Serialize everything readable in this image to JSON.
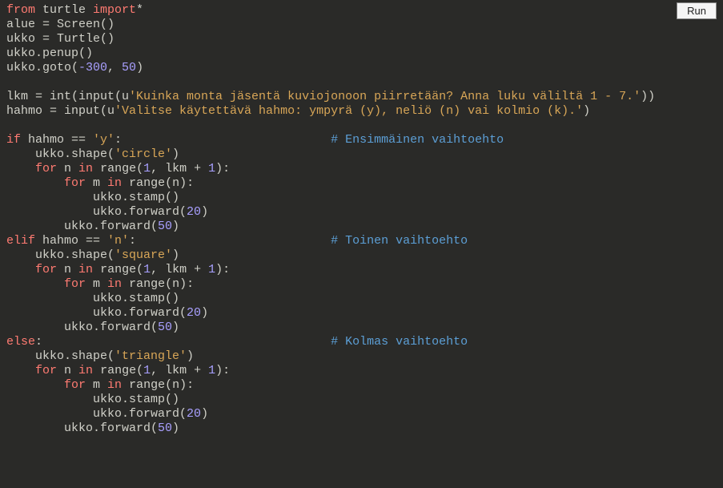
{
  "run_button": "Run",
  "code": {
    "lines": [
      [
        [
          "kw",
          "from"
        ],
        [
          "",
          " turtle "
        ],
        [
          "kw",
          "import"
        ],
        [
          "",
          "*"
        ]
      ],
      [
        [
          "",
          "alue = Screen()"
        ]
      ],
      [
        [
          "",
          "ukko = Turtle()"
        ]
      ],
      [
        [
          "",
          "ukko.penup()"
        ]
      ],
      [
        [
          "",
          "ukko.goto("
        ],
        [
          "num",
          "-300"
        ],
        [
          "",
          ", "
        ],
        [
          "num",
          "50"
        ],
        [
          "",
          ")"
        ]
      ],
      [
        [
          "",
          ""
        ]
      ],
      [
        [
          "",
          "lkm = int(input(u"
        ],
        [
          "str",
          "'Kuinka monta jäsentä kuviojonoon piirretään? Anna luku väliltä 1 - 7.'"
        ],
        [
          "",
          "))"
        ]
      ],
      [
        [
          "",
          "hahmo = input(u"
        ],
        [
          "str",
          "'Valitse käytettävä hahmo: ympyrä (y), neliö (n) vai kolmio (k).'"
        ],
        [
          "",
          ")"
        ]
      ],
      [
        [
          "",
          ""
        ]
      ],
      [
        [
          "kw",
          "if"
        ],
        [
          "",
          " hahmo == "
        ],
        [
          "str",
          "'y'"
        ],
        [
          "",
          ":                             "
        ],
        [
          "cmt",
          "# Ensimmäinen vaihtoehto"
        ]
      ],
      [
        [
          "",
          "    ukko.shape("
        ],
        [
          "str",
          "'circle'"
        ],
        [
          "",
          ")"
        ]
      ],
      [
        [
          "",
          "    "
        ],
        [
          "kw",
          "for"
        ],
        [
          "",
          " n "
        ],
        [
          "kw",
          "in"
        ],
        [
          "",
          " range("
        ],
        [
          "num",
          "1"
        ],
        [
          "",
          ", lkm + "
        ],
        [
          "num",
          "1"
        ],
        [
          "",
          "):"
        ]
      ],
      [
        [
          "",
          "        "
        ],
        [
          "kw",
          "for"
        ],
        [
          "",
          " m "
        ],
        [
          "kw",
          "in"
        ],
        [
          "",
          " range(n):"
        ]
      ],
      [
        [
          "",
          "            ukko.stamp()"
        ]
      ],
      [
        [
          "",
          "            ukko.forward("
        ],
        [
          "num",
          "20"
        ],
        [
          "",
          ")"
        ]
      ],
      [
        [
          "",
          "        ukko.forward("
        ],
        [
          "num",
          "50"
        ],
        [
          "",
          ")"
        ]
      ],
      [
        [
          "kw",
          "elif"
        ],
        [
          "",
          " hahmo == "
        ],
        [
          "str",
          "'n'"
        ],
        [
          "",
          ":                           "
        ],
        [
          "cmt",
          "# Toinen vaihtoehto"
        ]
      ],
      [
        [
          "",
          "    ukko.shape("
        ],
        [
          "str",
          "'square'"
        ],
        [
          "",
          ")"
        ]
      ],
      [
        [
          "",
          "    "
        ],
        [
          "kw",
          "for"
        ],
        [
          "",
          " n "
        ],
        [
          "kw",
          "in"
        ],
        [
          "",
          " range("
        ],
        [
          "num",
          "1"
        ],
        [
          "",
          ", lkm + "
        ],
        [
          "num",
          "1"
        ],
        [
          "",
          "):"
        ]
      ],
      [
        [
          "",
          "        "
        ],
        [
          "kw",
          "for"
        ],
        [
          "",
          " m "
        ],
        [
          "kw",
          "in"
        ],
        [
          "",
          " range(n):"
        ]
      ],
      [
        [
          "",
          "            ukko.stamp()"
        ]
      ],
      [
        [
          "",
          "            ukko.forward("
        ],
        [
          "num",
          "20"
        ],
        [
          "",
          ")"
        ]
      ],
      [
        [
          "",
          "        ukko.forward("
        ],
        [
          "num",
          "50"
        ],
        [
          "",
          ")"
        ]
      ],
      [
        [
          "kw",
          "else"
        ],
        [
          "",
          ":                                        "
        ],
        [
          "cmt",
          "# Kolmas vaihtoehto"
        ]
      ],
      [
        [
          "",
          "    ukko.shape("
        ],
        [
          "str",
          "'triangle'"
        ],
        [
          "",
          ")"
        ]
      ],
      [
        [
          "",
          "    "
        ],
        [
          "kw",
          "for"
        ],
        [
          "",
          " n "
        ],
        [
          "kw",
          "in"
        ],
        [
          "",
          " range("
        ],
        [
          "num",
          "1"
        ],
        [
          "",
          ", lkm + "
        ],
        [
          "num",
          "1"
        ],
        [
          "",
          "):"
        ]
      ],
      [
        [
          "",
          "        "
        ],
        [
          "kw",
          "for"
        ],
        [
          "",
          " m "
        ],
        [
          "kw",
          "in"
        ],
        [
          "",
          " range(n):"
        ]
      ],
      [
        [
          "",
          "            ukko.stamp()"
        ]
      ],
      [
        [
          "",
          "            ukko.forward("
        ],
        [
          "num",
          "20"
        ],
        [
          "",
          ")"
        ]
      ],
      [
        [
          "",
          "        ukko.forward("
        ],
        [
          "num",
          "50"
        ],
        [
          "",
          ")"
        ]
      ]
    ]
  }
}
